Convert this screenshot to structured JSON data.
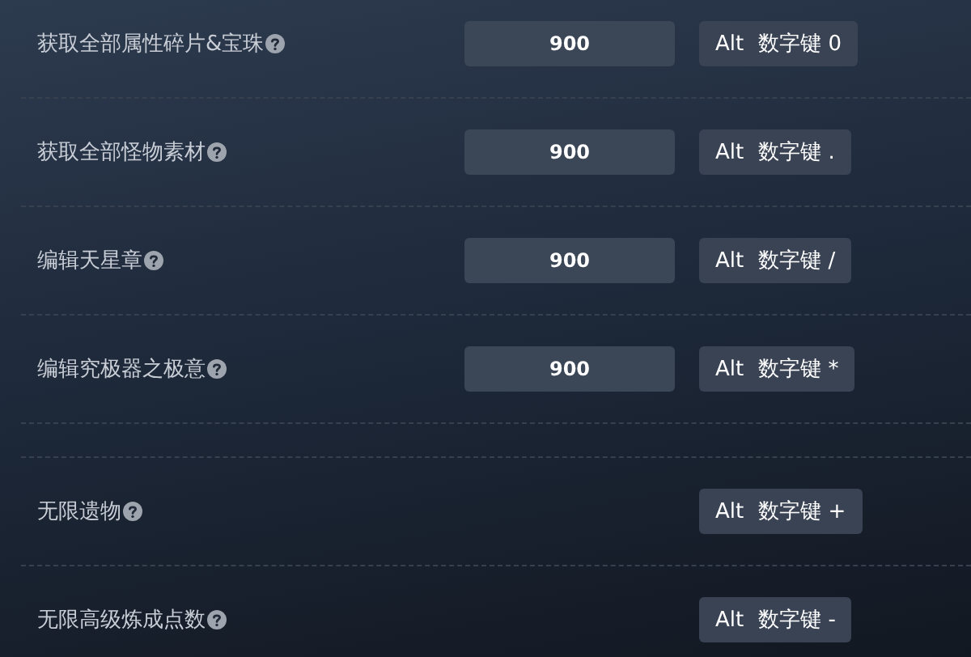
{
  "sections": [
    {
      "rows": [
        {
          "label": "获取全部属性碎片&宝珠",
          "value": "900",
          "hotkey": [
            "Alt",
            "数字键 0"
          ]
        },
        {
          "label": "获取全部怪物素材",
          "value": "900",
          "hotkey": [
            "Alt",
            "数字键 ."
          ]
        },
        {
          "label": "编辑天星章",
          "value": "900",
          "hotkey": [
            "Alt",
            "数字键 /"
          ]
        },
        {
          "label": "编辑究极器之极意",
          "value": "900",
          "hotkey": [
            "Alt",
            "数字键 *"
          ]
        }
      ]
    },
    {
      "rows": [
        {
          "label": "无限遗物",
          "hotkey": [
            "Alt",
            "数字键 +"
          ]
        },
        {
          "label": "无限高级炼成点数",
          "hotkey": [
            "Alt",
            "数字键 -"
          ]
        }
      ]
    }
  ]
}
